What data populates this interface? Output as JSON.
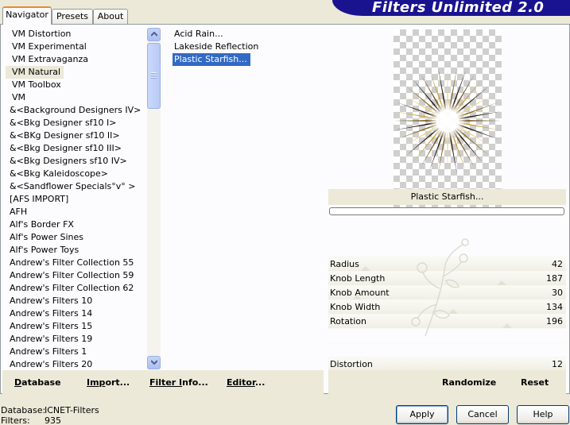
{
  "tabs": [
    {
      "label": "Navigator",
      "active": true
    },
    {
      "label": "Presets",
      "active": false
    },
    {
      "label": "About",
      "active": false
    }
  ],
  "banner": {
    "title": "Filters Unlimited 2.0",
    "color": "#1a1390"
  },
  "categories": [
    {
      "label": "VM Distortion"
    },
    {
      "label": "VM Experimental"
    },
    {
      "label": "VM Extravaganza"
    },
    {
      "label": "VM Natural",
      "selected": true
    },
    {
      "label": "VM Toolbox"
    },
    {
      "label": "VM"
    },
    {
      "label": "&<Background Designers IV>"
    },
    {
      "label": "&<Bkg Designer sf10 I>"
    },
    {
      "label": "&<BKg Designer sf10 II>"
    },
    {
      "label": "&<Bkg Designer sf10 III>"
    },
    {
      "label": "&<Bkg Designers sf10 IV>"
    },
    {
      "label": "&<Bkg Kaleidoscope>"
    },
    {
      "label": "&<Sandflower Specials°v° >"
    },
    {
      "label": "[AFS IMPORT]"
    },
    {
      "label": "AFH"
    },
    {
      "label": "Alf's Border FX"
    },
    {
      "label": "Alf's Power Sines"
    },
    {
      "label": "Alf's Power Toys"
    },
    {
      "label": "Andrew's Filter Collection 55"
    },
    {
      "label": "Andrew's Filter Collection 59"
    },
    {
      "label": "Andrew's Filter Collection 62"
    },
    {
      "label": "Andrew's Filters 10"
    },
    {
      "label": "Andrew's Filters 14"
    },
    {
      "label": "Andrew's Filters 15"
    },
    {
      "label": "Andrew's Filters 19"
    },
    {
      "label": "Andrew's Filters 1"
    },
    {
      "label": "Andrew's Filters 20"
    }
  ],
  "filters": [
    {
      "label": "Acid Rain...",
      "selected": false
    },
    {
      "label": "Lakeside Reflection",
      "selected": false
    },
    {
      "label": "Plastic Starfish...",
      "selected": true
    }
  ],
  "preview": {
    "filter_name": "Plastic Starfish..."
  },
  "parameters": [
    {
      "label": "Radius",
      "value": "42"
    },
    {
      "label": "Knob Length",
      "value": "187"
    },
    {
      "label": "Knob Amount",
      "value": "30"
    },
    {
      "label": "Knob Width",
      "value": "134"
    },
    {
      "label": "Rotation",
      "value": "196"
    },
    {
      "label": "",
      "value": ""
    },
    {
      "label": "",
      "value": ""
    },
    {
      "label": "Distortion",
      "value": "12"
    }
  ],
  "links_left": [
    {
      "label": "Database",
      "underline": "D",
      "rest": "atabase"
    },
    {
      "label": "Import...",
      "underline": "Imp",
      "rest": "ort..."
    },
    {
      "label": "Filter Info...",
      "underline": "Filter I",
      "rest": "nfo..."
    },
    {
      "label": "Editor...",
      "underline": "Editor",
      "rest": "..."
    }
  ],
  "links_right": [
    {
      "label": "Randomize"
    },
    {
      "label": "Reset"
    }
  ],
  "status": {
    "database_label": "Database:",
    "database_value": "ICNET-Filters",
    "filters_label": "Filters:",
    "filters_value": "935"
  },
  "buttons": {
    "apply": "Apply",
    "cancel": "Cancel",
    "help": "Help"
  }
}
